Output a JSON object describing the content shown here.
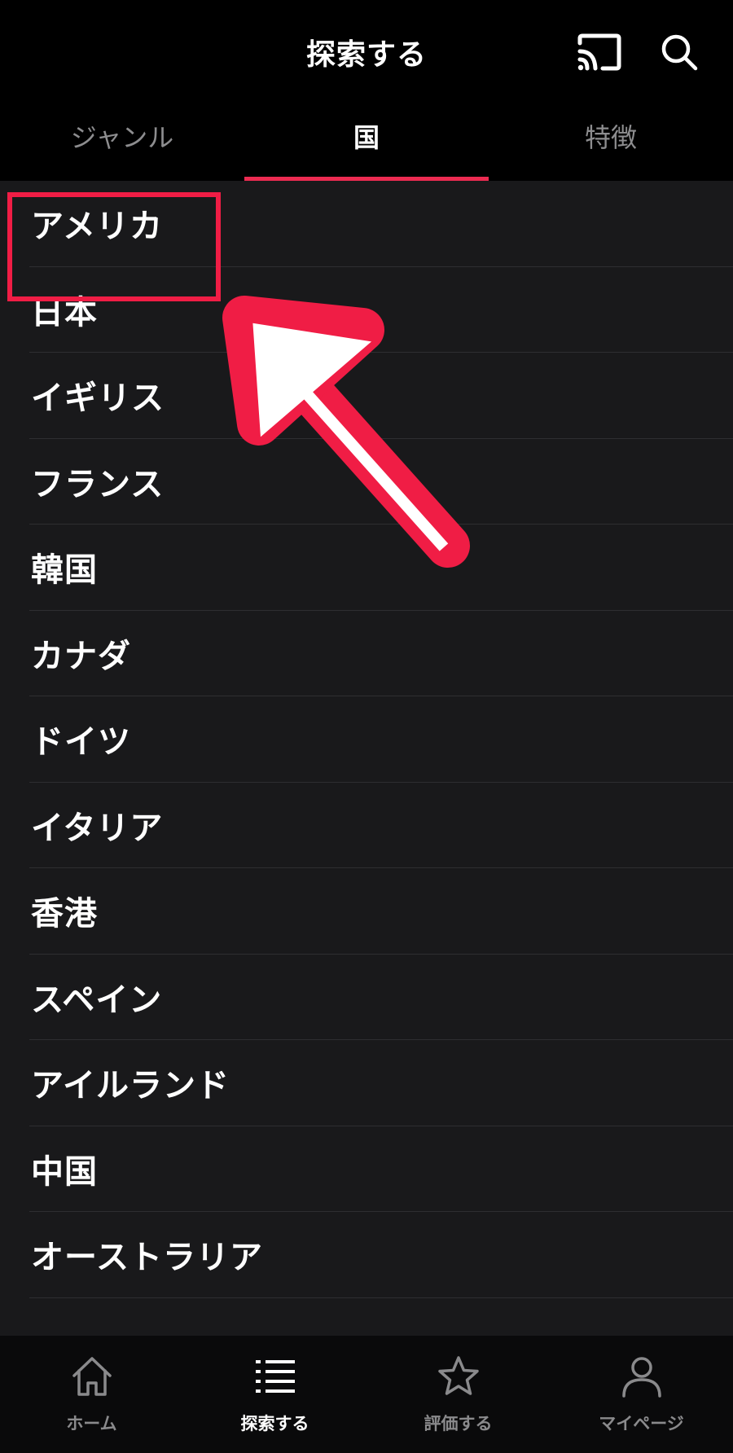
{
  "header": {
    "title": "探索する",
    "cast_icon": "cast-icon",
    "search_icon": "search-icon"
  },
  "tabs": [
    {
      "label": "ジャンル",
      "active": false
    },
    {
      "label": "国",
      "active": true
    },
    {
      "label": "特徴",
      "active": false
    }
  ],
  "countries": [
    "アメリカ",
    "日本",
    "イギリス",
    "フランス",
    "韓国",
    "カナダ",
    "ドイツ",
    "イタリア",
    "香港",
    "スペイン",
    "アイルランド",
    "中国",
    "オーストラリア"
  ],
  "annotation": {
    "color": "#f01d45",
    "highlighted_item": "アメリカ"
  },
  "bottom_nav": [
    {
      "label": "ホーム",
      "icon": "home-icon",
      "active": false
    },
    {
      "label": "探索する",
      "icon": "list-icon",
      "active": true
    },
    {
      "label": "評価する",
      "icon": "star-icon",
      "active": false
    },
    {
      "label": "マイページ",
      "icon": "person-icon",
      "active": false
    }
  ],
  "colors": {
    "accent": "#ec2b51",
    "background": "#19191b"
  }
}
